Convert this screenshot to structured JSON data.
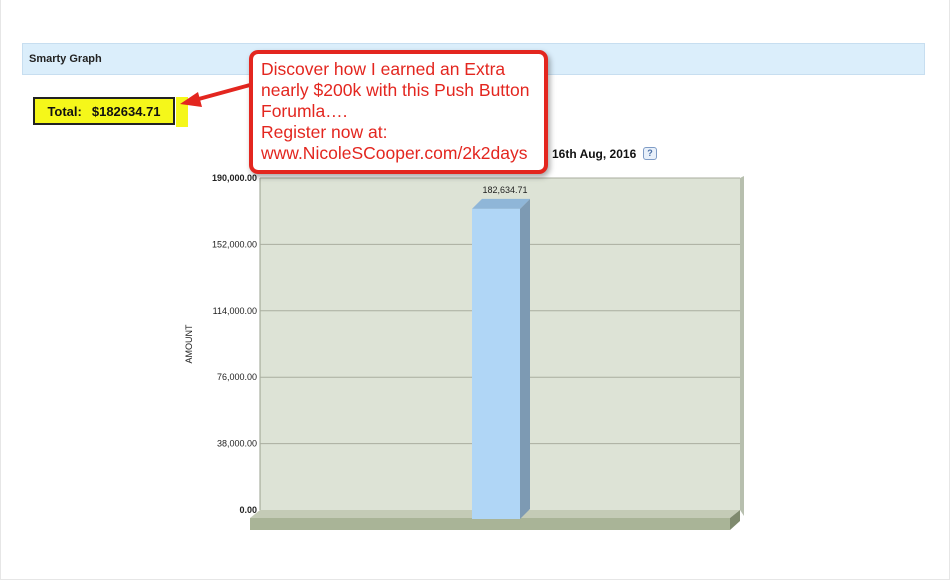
{
  "panel": {
    "title": "Smarty Graph"
  },
  "total": {
    "label": "Total:",
    "value": "$182634.71"
  },
  "promo": {
    "lines": [
      "Discover how I earned an Extra",
      "nearly $200k with this Push Button",
      "Forumla….",
      "Register now at:",
      "www.NicoleSCooper.com/2k2days"
    ],
    "color": "#e3261f"
  },
  "chart_title_visible": "16th Aug, 2016",
  "help_icon": "?",
  "chart_data": {
    "type": "bar",
    "categories": [
      ""
    ],
    "values": [
      182634.71
    ],
    "data_labels": [
      "182,634.71"
    ],
    "ylabel": "AMOUNT",
    "xlabel": "",
    "ylim": [
      0,
      190000
    ],
    "yticks": [
      0,
      38000,
      76000,
      114000,
      152000,
      190000
    ],
    "ytick_labels": [
      "0.00",
      "38,000.00",
      "76,000.00",
      "114,000.00",
      "152,000.00",
      "190,000.00"
    ],
    "grid": true,
    "bar_color": "#b0d6f6",
    "plot_background": "#dde3d6"
  }
}
